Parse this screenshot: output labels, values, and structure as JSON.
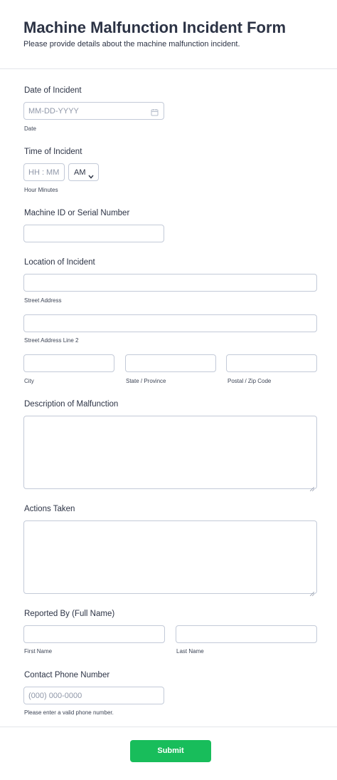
{
  "form": {
    "title": "Machine Malfunction Incident Form",
    "subtitle": "Please provide details about the machine malfunction incident."
  },
  "date_of_incident": {
    "label": "Date of Incident",
    "placeholder": "MM-DD-YYYY",
    "sublabel": "Date",
    "icon": "calendar-icon"
  },
  "time_of_incident": {
    "label": "Time of Incident",
    "placeholder": "HH : MM",
    "ampm_value": "AM",
    "sublabel": "Hour Minutes"
  },
  "machine_id": {
    "label": "Machine ID or Serial Number"
  },
  "location": {
    "label": "Location of Incident",
    "street_sublabel": "Street Address",
    "street2_sublabel": "Street Address Line 2",
    "city_sublabel": "City",
    "state_sublabel": "State / Province",
    "zip_sublabel": "Postal / Zip Code"
  },
  "description": {
    "label": "Description of Malfunction"
  },
  "actions": {
    "label": "Actions Taken"
  },
  "reported_by": {
    "label": "Reported By (Full Name)",
    "first_sublabel": "First Name",
    "last_sublabel": "Last Name"
  },
  "phone": {
    "label": "Contact Phone Number",
    "placeholder": "(000) 000-0000",
    "sublabel": "Please enter a valid phone number."
  },
  "submit": {
    "label": "Submit",
    "color": "#18bd5b"
  }
}
